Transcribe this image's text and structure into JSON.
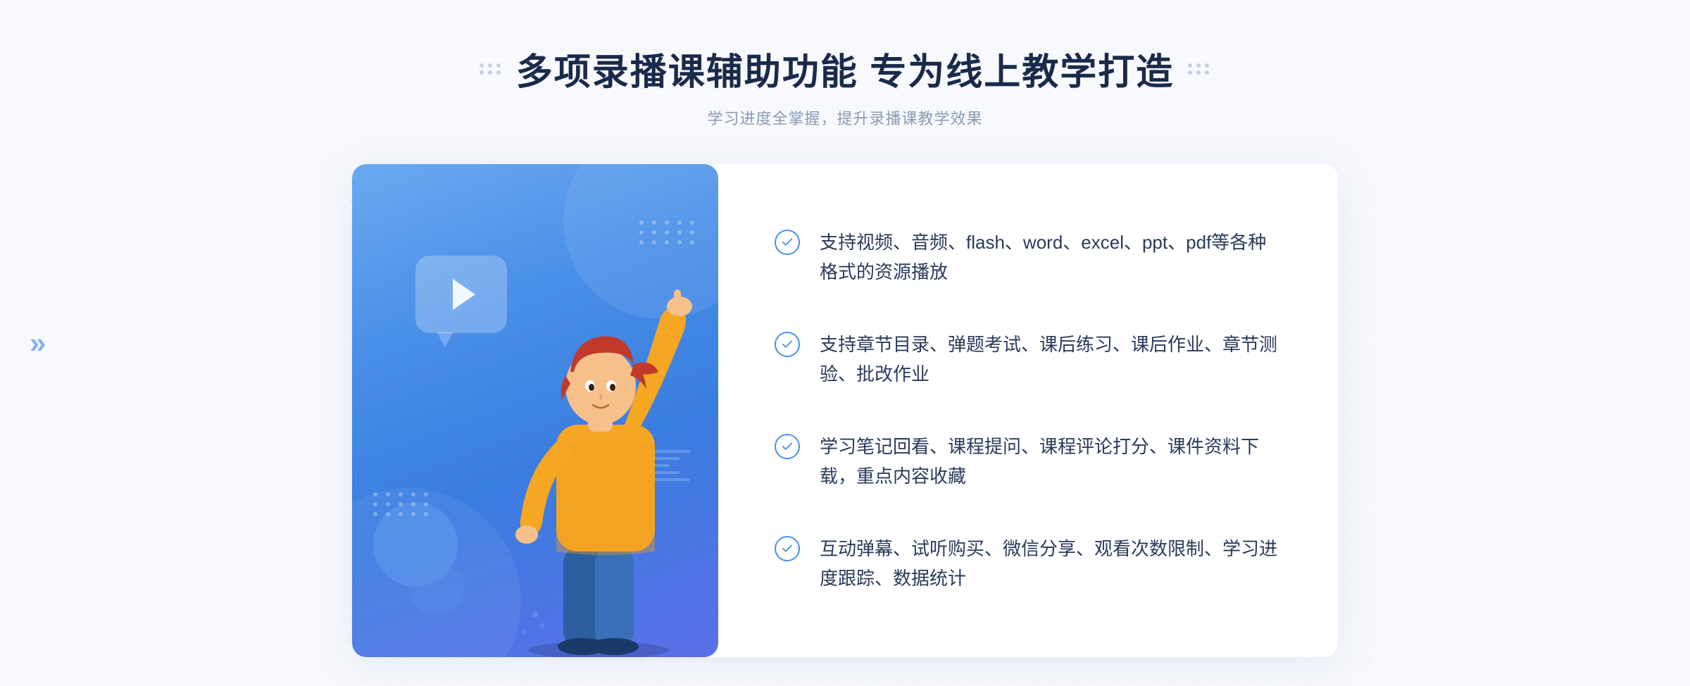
{
  "header": {
    "title": "多项录播课辅助功能 专为线上教学打造",
    "subtitle": "学习进度全掌握，提升录播课教学效果"
  },
  "decorative": {
    "left_chevron": "»",
    "right_dots": "⁝⁝"
  },
  "features": [
    {
      "id": 1,
      "text": "支持视频、音频、flash、word、excel、ppt、pdf等各种格式的资源播放"
    },
    {
      "id": 2,
      "text": "支持章节目录、弹题考试、课后练习、课后作业、章节测验、批改作业"
    },
    {
      "id": 3,
      "text": "学习笔记回看、课程提问、课程评论打分、课件资料下载，重点内容收藏"
    },
    {
      "id": 4,
      "text": "互动弹幕、试听购买、微信分享、观看次数限制、学习进度跟踪、数据统计"
    }
  ],
  "illustration": {
    "play_button_alt": "video play button",
    "person_alt": "person pointing up illustration"
  },
  "colors": {
    "primary_blue": "#4a8fe8",
    "gradient_start": "#6baaf0",
    "gradient_end": "#5b6fe8",
    "text_dark": "#1a2a4a",
    "text_light": "#8a9ab5",
    "feature_text": "#2a3a5a"
  }
}
